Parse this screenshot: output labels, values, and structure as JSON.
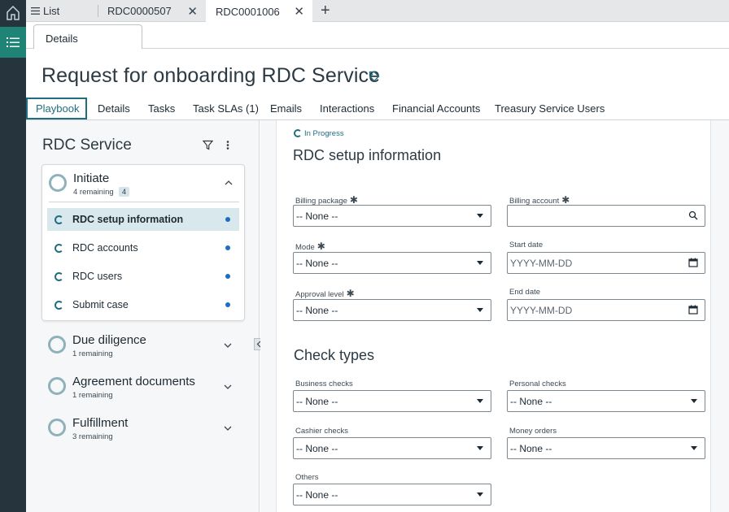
{
  "tabs": {
    "list_label": "List",
    "tab1_label": "RDC0000507",
    "tab2_label": "RDC0001006",
    "close_glyph": "✕",
    "new_tab_glyph": "+"
  },
  "subtab": {
    "label": "Details"
  },
  "record": {
    "title": "Request for onboarding RDC Service"
  },
  "page_tabs": [
    "Playbook",
    "Details",
    "Tasks",
    "Task SLAs (1)",
    "Emails",
    "Interactions",
    "Financial Accounts",
    "Treasury Service Users"
  ],
  "playbook": {
    "title": "RDC Service",
    "stages": [
      {
        "name": "Initiate",
        "remaining": "4 remaining",
        "badge": "4",
        "activities": [
          "RDC setup information",
          "RDC accounts",
          "RDC users",
          "Submit case"
        ]
      },
      {
        "name": "Due diligence",
        "remaining": "1 remaining"
      },
      {
        "name": "Agreement documents",
        "remaining": "1 remaining"
      },
      {
        "name": "Fulfillment",
        "remaining": "3 remaining"
      }
    ]
  },
  "form": {
    "status": "In Progress",
    "section1_title": "RDC setup information",
    "billing_package": {
      "label": "Billing package",
      "value": "-- None --"
    },
    "billing_account": {
      "label": "Billing account",
      "value": ""
    },
    "mode": {
      "label": "Mode",
      "value": "-- None --"
    },
    "start_date": {
      "label": "Start date",
      "placeholder": "YYYY-MM-DD"
    },
    "approval_level": {
      "label": "Approval level",
      "value": "-- None --"
    },
    "end_date": {
      "label": "End date",
      "placeholder": "YYYY-MM-DD"
    },
    "section2_title": "Check types",
    "business_checks": {
      "label": "Business checks",
      "value": "-- None --"
    },
    "personal_checks": {
      "label": "Personal checks",
      "value": "-- None --"
    },
    "cashier_checks": {
      "label": "Cashier checks",
      "value": "-- None --"
    },
    "money_orders": {
      "label": "Money orders",
      "value": "-- None --"
    },
    "others": {
      "label": "Others",
      "value": "-- None --"
    }
  },
  "icons": {
    "home": "home-icon",
    "list": "list-icon",
    "tag": "tag-icon",
    "filter": "filter-icon",
    "kebab": "more-vertical-icon",
    "search": "search-icon",
    "calendar": "calendar-icon",
    "chevron_up": "chevron-up-icon",
    "chevron_down": "chevron-down-icon",
    "collapse": "chevron-left-icon"
  },
  "colors": {
    "rail": "#26353d",
    "rail_active": "#1f8476",
    "accent": "#1f6e80",
    "dot": "#1b6ec2",
    "ring": "#8fb2ba"
  }
}
